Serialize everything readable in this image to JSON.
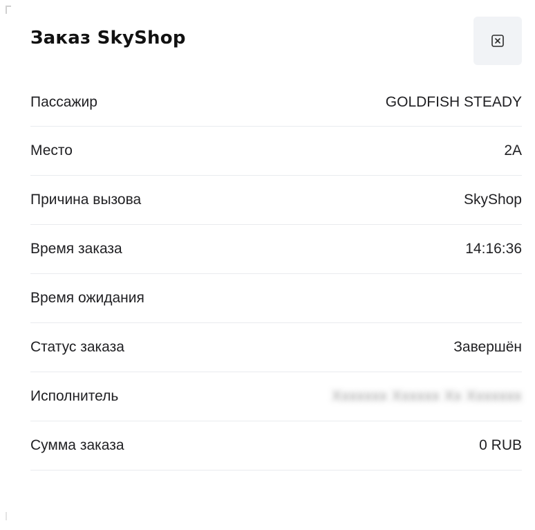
{
  "modal": {
    "title": "Заказ SkyShop",
    "close_icon": "close-icon"
  },
  "rows": [
    {
      "label": "Пассажир",
      "value": "GOLDFISH STEADY"
    },
    {
      "label": "Место",
      "value": "2A"
    },
    {
      "label": "Причина вызова",
      "value": "SkyShop"
    },
    {
      "label": "Время заказа",
      "value": "14:16:36"
    },
    {
      "label": "Время ожидания",
      "value": ""
    },
    {
      "label": "Статус заказа",
      "value": "Завершён"
    },
    {
      "label": "Исполнитель",
      "value": ""
    },
    {
      "label": "Сумма заказа",
      "value": "0 RUB"
    }
  ],
  "colors": {
    "close_button_bg": "#f1f3f6",
    "divider": "#e9ebee",
    "text": "#1f1f22"
  }
}
